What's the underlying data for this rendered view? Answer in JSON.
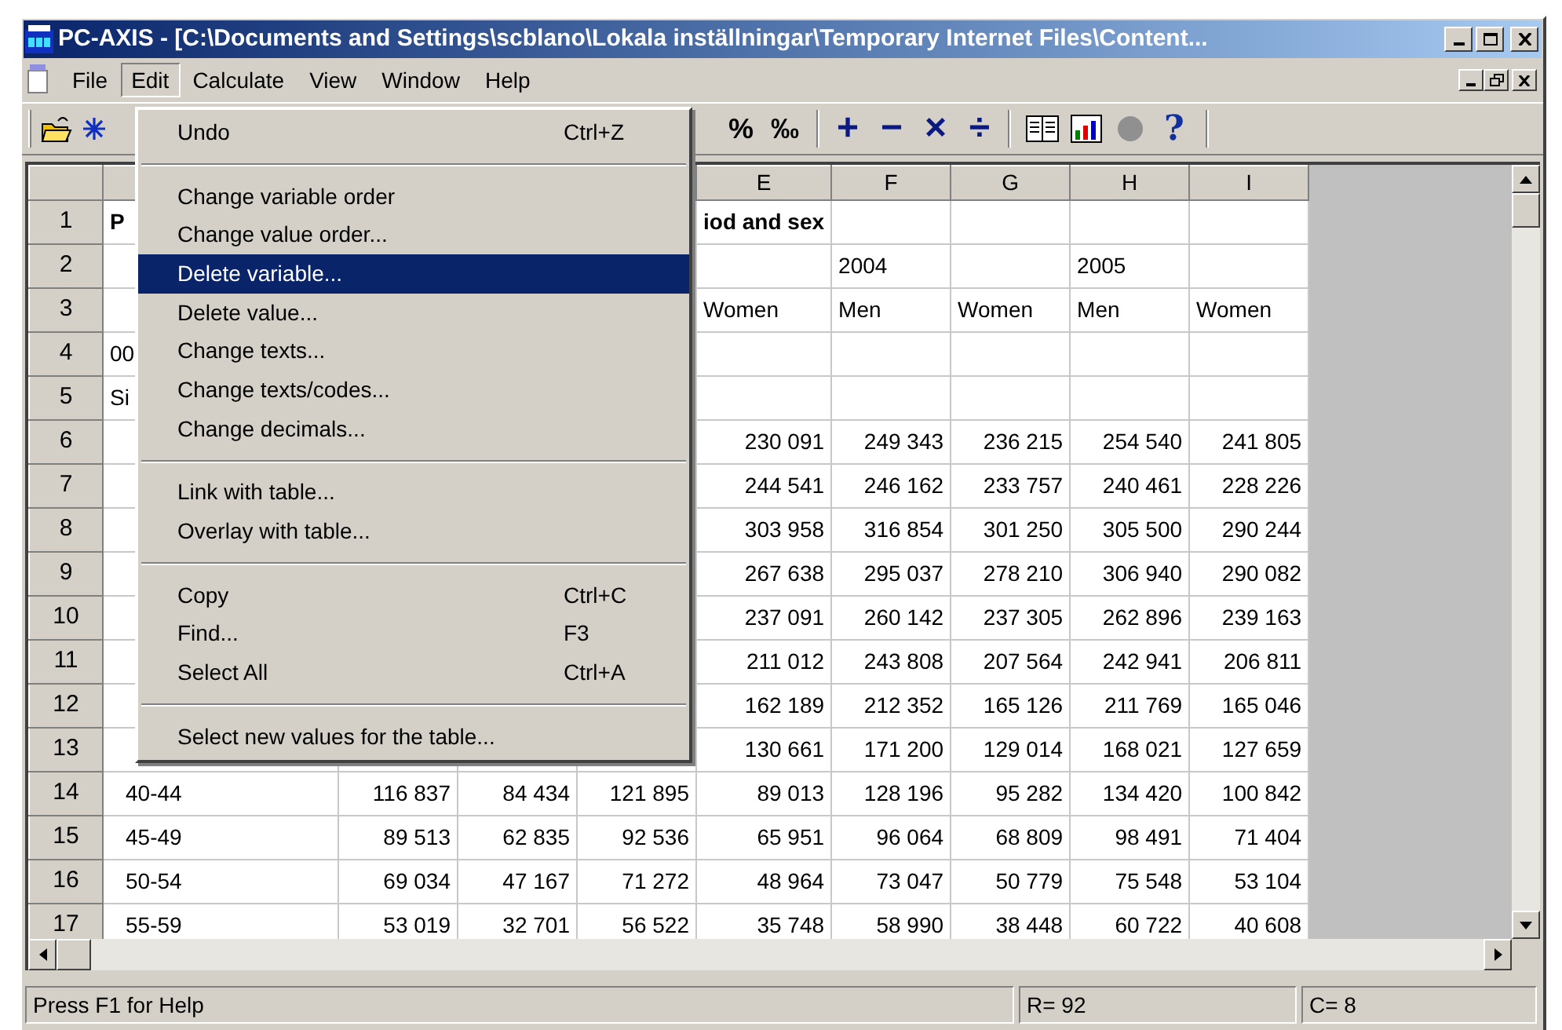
{
  "window": {
    "title": "PC-AXIS - [C:\\Documents and Settings\\scblano\\Lokala inställningar\\Temporary Internet Files\\Content..."
  },
  "menus": [
    {
      "label": "File",
      "selected": false
    },
    {
      "label": "Edit",
      "selected": true
    },
    {
      "label": "Calculate",
      "selected": false
    },
    {
      "label": "View",
      "selected": false
    },
    {
      "label": "Window",
      "selected": false
    },
    {
      "label": "Help",
      "selected": false
    }
  ],
  "toolbar": {
    "percent_buttons": [
      "%",
      "‰"
    ],
    "arithmetic_buttons": [
      "+",
      "−",
      "×",
      "÷"
    ],
    "help_button": "?"
  },
  "edit_menu": [
    {
      "kind": "item",
      "label": "Undo",
      "shortcut": "Ctrl+Z",
      "selected": false
    },
    {
      "kind": "separator"
    },
    {
      "kind": "item",
      "label": "Change variable order",
      "selected": false
    },
    {
      "kind": "item",
      "label": "Change value order...",
      "selected": false
    },
    {
      "kind": "item",
      "label": "Delete variable...",
      "selected": true
    },
    {
      "kind": "item",
      "label": "Delete value...",
      "selected": false
    },
    {
      "kind": "item",
      "label": "Change texts...",
      "selected": false
    },
    {
      "kind": "item",
      "label": "Change texts/codes...",
      "selected": false
    },
    {
      "kind": "item",
      "label": "Change decimals...",
      "selected": false
    },
    {
      "kind": "separator"
    },
    {
      "kind": "item",
      "label": "Link with table...",
      "selected": false
    },
    {
      "kind": "item",
      "label": "Overlay with table...",
      "selected": false
    },
    {
      "kind": "separator"
    },
    {
      "kind": "item",
      "label": "Copy",
      "shortcut": "Ctrl+C",
      "selected": false
    },
    {
      "kind": "item",
      "label": "Find...",
      "shortcut": "F3",
      "selected": false
    },
    {
      "kind": "item",
      "label": "Select All",
      "shortcut": "Ctrl+A",
      "selected": false
    },
    {
      "kind": "separator"
    },
    {
      "kind": "item",
      "label": "Select new values for the table...",
      "selected": false
    }
  ],
  "table": {
    "columns": [
      null,
      null,
      null,
      null,
      "E",
      "F",
      "G",
      "H",
      "I"
    ],
    "rows": [
      {
        "number": "1",
        "kind": "title",
        "cells": [
          "P",
          null,
          null,
          null,
          "iod and sex",
          null,
          null,
          null,
          null
        ]
      },
      {
        "number": "2",
        "kind": "header",
        "cells": [
          null,
          null,
          null,
          null,
          null,
          "2004",
          null,
          "2005",
          null
        ]
      },
      {
        "number": "3",
        "kind": "header",
        "cells": [
          null,
          null,
          null,
          null,
          "Women",
          "Men",
          "Women",
          "Men",
          "Women"
        ]
      },
      {
        "number": "4",
        "kind": "header",
        "cells": [
          "00",
          null,
          null,
          null,
          null,
          null,
          null,
          null,
          null
        ]
      },
      {
        "number": "5",
        "kind": "header",
        "cells": [
          "Si",
          null,
          null,
          null,
          null,
          null,
          null,
          null,
          null
        ]
      },
      {
        "number": "6",
        "kind": "data",
        "cells": [
          null,
          null,
          null,
          null,
          "230 091",
          "249 343",
          "236 215",
          "254 540",
          "241 805"
        ]
      },
      {
        "number": "7",
        "kind": "data",
        "cells": [
          null,
          null,
          null,
          null,
          "244 541",
          "246 162",
          "233 757",
          "240 461",
          "228 226"
        ]
      },
      {
        "number": "8",
        "kind": "data",
        "cells": [
          null,
          null,
          null,
          null,
          "303 958",
          "316 854",
          "301 250",
          "305 500",
          "290 244"
        ]
      },
      {
        "number": "9",
        "kind": "data",
        "cells": [
          null,
          null,
          null,
          null,
          "267 638",
          "295 037",
          "278 210",
          "306 940",
          "290 082"
        ]
      },
      {
        "number": "10",
        "kind": "data",
        "cells": [
          null,
          null,
          null,
          null,
          "237 091",
          "260 142",
          "237 305",
          "262 896",
          "239 163"
        ]
      },
      {
        "number": "11",
        "kind": "data",
        "cells": [
          null,
          null,
          null,
          null,
          "211 012",
          "243 808",
          "207 564",
          "242 941",
          "206 811"
        ]
      },
      {
        "number": "12",
        "kind": "data",
        "cells": [
          null,
          null,
          null,
          null,
          "162 189",
          "212 352",
          "165 126",
          "211 769",
          "165 046"
        ]
      },
      {
        "number": "13",
        "kind": "data",
        "cells": [
          null,
          null,
          null,
          null,
          "130 661",
          "171 200",
          "129 014",
          "168 021",
          "127 659"
        ]
      },
      {
        "number": "14",
        "kind": "data",
        "cells": [
          "40-44",
          "116 837",
          "84 434",
          "121 895",
          "89 013",
          "128 196",
          "95 282",
          "134 420",
          "100 842"
        ]
      },
      {
        "number": "15",
        "kind": "data",
        "cells": [
          "45-49",
          "89 513",
          "62 835",
          "92 536",
          "65 951",
          "96 064",
          "68 809",
          "98 491",
          "71 404"
        ]
      },
      {
        "number": "16",
        "kind": "data",
        "cells": [
          "50-54",
          "69 034",
          "47 167",
          "71 272",
          "48 964",
          "73 047",
          "50 779",
          "75 548",
          "53 104"
        ]
      },
      {
        "number": "17",
        "kind": "data",
        "cells": [
          "55-59",
          "53 019",
          "32 701",
          "56 522",
          "35 748",
          "58 990",
          "38 448",
          "60 722",
          "40 608"
        ]
      }
    ]
  },
  "status_bar": {
    "help": "Press F1 for Help",
    "rows": "R= 92",
    "columns": "C= 8"
  }
}
